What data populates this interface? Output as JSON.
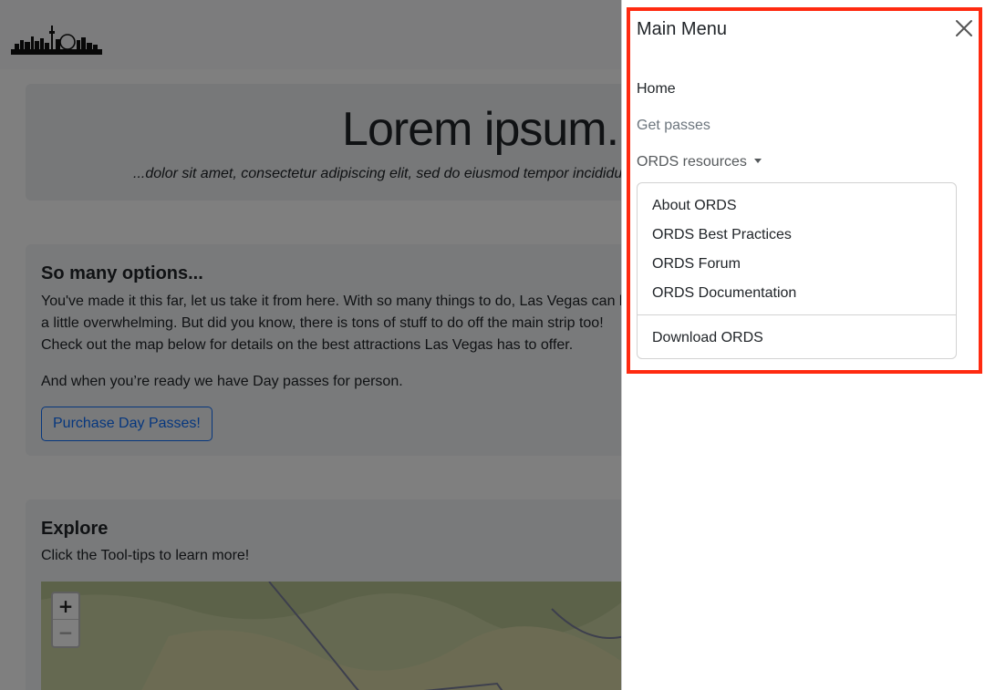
{
  "hero": {
    "title": "Lorem ipsum...",
    "subtitle": "...dolor sit amet, consectetur adipiscing elit, sed do eiusmod tempor incididunt ut labore et dolore magna aliqua."
  },
  "options_card": {
    "title": "So many options...",
    "text": "You've made it this far, let us take it from here. With so many things to do, Las Vegas can be a little overwhelming. But did you know, there is tons of stuff to do off the main strip too! Check out the map below for details on the best attractions Las Vegas has to offer.",
    "text2": "And when you’re ready we have Day passes for person.",
    "button_label": "Purchase Day Passes!"
  },
  "explore_card": {
    "title": "Explore",
    "text": "Click the Tool-tips to learn more!",
    "zoom_in": "+",
    "zoom_out": "−"
  },
  "offcanvas": {
    "title": "Main Menu",
    "nav": {
      "home": "Home",
      "get_passes": "Get passes",
      "ords_resources": "ORDS resources"
    },
    "dropdown": {
      "items": [
        "About ORDS",
        "ORDS Best Practices",
        "ORDS Forum",
        "ORDS Documentation"
      ],
      "footer_item": "Download ORDS"
    }
  },
  "colors": {
    "primary": "#0d6efd",
    "highlight": "#ff2a10",
    "muted": "#6c757d"
  },
  "icons": {
    "close": "close-icon",
    "caret": "caret-down-icon",
    "logo": "las-vegas-skyline-logo"
  }
}
